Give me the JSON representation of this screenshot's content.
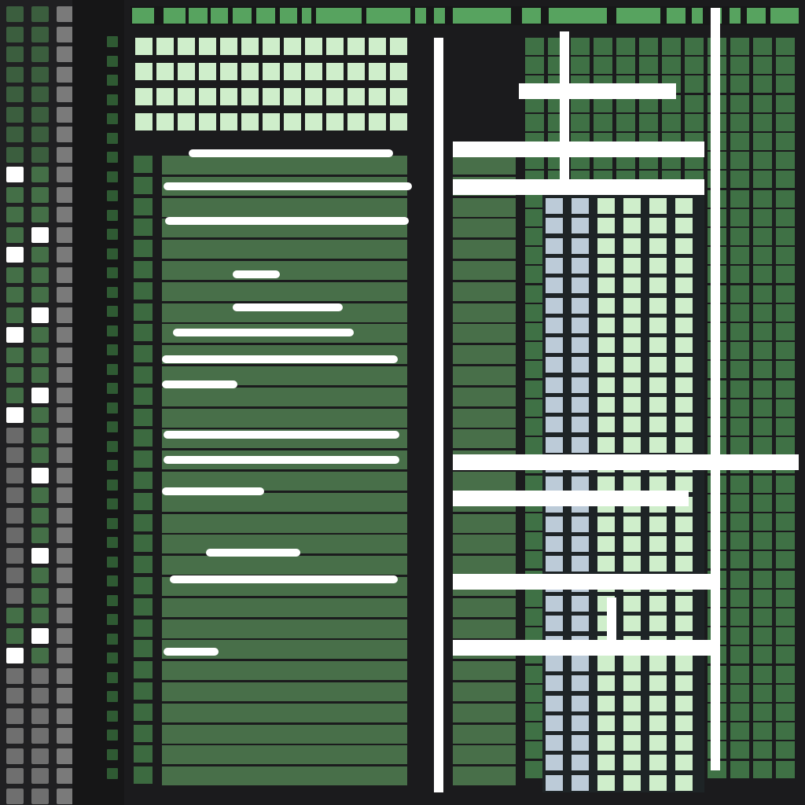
{
  "colors": {
    "background": "#1b1b1d",
    "panel": "#202022",
    "row_green": "#486f49",
    "header_green": "#57a35f",
    "light_green": "#cfeecb",
    "highlight_blue": "#bccbd8",
    "white": "#ffffff"
  },
  "icons": {
    "tool_palette": "grid-tool-icon",
    "row_marker": "row-marker-icon"
  },
  "list": {
    "row_count": 30
  }
}
